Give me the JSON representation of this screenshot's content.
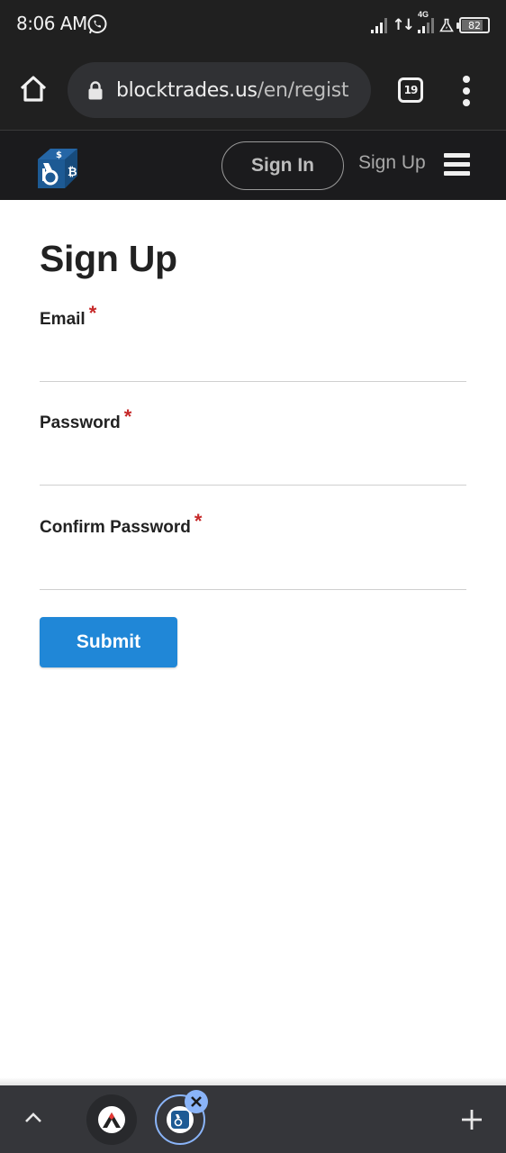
{
  "status_bar": {
    "time": "8:06 AM",
    "network_label": "4G",
    "battery_percent": "82",
    "battery_level": 0.82
  },
  "browser": {
    "url_domain": "blocktrades.us",
    "url_path": "/en/regist",
    "tab_count": "19",
    "icons": {
      "home": "home-icon",
      "lock": "lock-icon",
      "menu": "more-vert-icon"
    }
  },
  "site_header": {
    "logo_alt": "BlockTrades logo",
    "sign_in_label": "Sign In",
    "sign_up_label": "Sign Up",
    "menu_icon": "hamburger-icon"
  },
  "form": {
    "title": "Sign Up",
    "required_marker": "*",
    "fields": [
      {
        "label": "Email",
        "value": "",
        "placeholder": ""
      },
      {
        "label": "Password",
        "value": "",
        "placeholder": ""
      },
      {
        "label": "Confirm Password",
        "value": "",
        "placeholder": ""
      }
    ],
    "submit_label": "Submit"
  },
  "bottom_bar": {
    "tabs": [
      {
        "name": "tab-thumbnail-1",
        "active": false
      },
      {
        "name": "tab-thumbnail-blocktrades",
        "active": true
      }
    ]
  },
  "colors": {
    "accent": "#2087d7",
    "required": "#c62828",
    "header_bg": "#1b1b1d",
    "active_tab_ring": "#8ab4f8"
  }
}
